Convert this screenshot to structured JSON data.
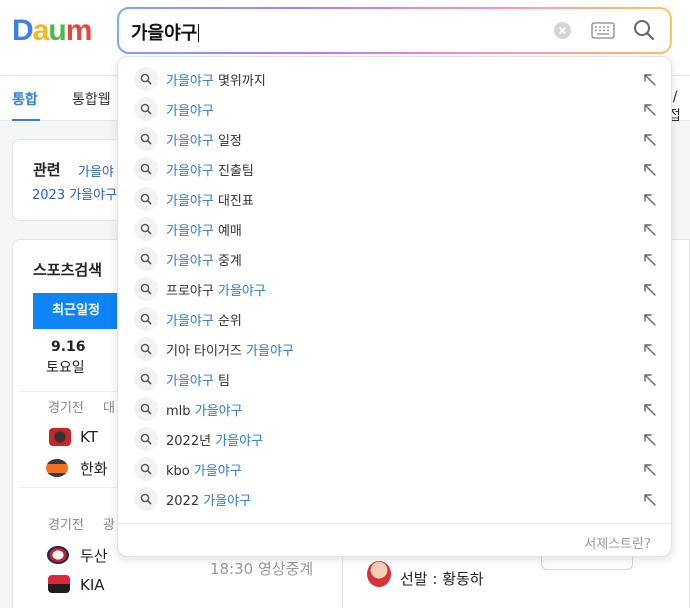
{
  "header": {
    "logo": "Daum",
    "search_value": "가을야구"
  },
  "nav": {
    "tabs": [
      "통합",
      "통합웹"
    ],
    "right_fragment": "|/접"
  },
  "related": {
    "title": "관련",
    "link1": "가을야",
    "link2": "2023 가을야구"
  },
  "sports": {
    "title": "스포츠검색",
    "tab_recent": "최근일정",
    "date": "9.16",
    "weekday": "토요일",
    "game1": {
      "label": "경기전",
      "venue": "대",
      "team1": "KT",
      "team2": "한화"
    },
    "game2": {
      "label": "경기전",
      "venue": "광",
      "team1": "두산",
      "team2": "KIA",
      "time": "18:30 영상중계",
      "pitcher": "선발 : 황동하"
    }
  },
  "suggestions": [
    {
      "before": "",
      "highlight": "가을야구",
      "after": " 몇위까지"
    },
    {
      "before": "",
      "highlight": "가을야구",
      "after": ""
    },
    {
      "before": "",
      "highlight": "가을야구",
      "after": " 일정"
    },
    {
      "before": "",
      "highlight": "가을야구",
      "after": " 진출팀"
    },
    {
      "before": "",
      "highlight": "가을야구",
      "after": " 대진표"
    },
    {
      "before": "",
      "highlight": "가을야구",
      "after": " 예매"
    },
    {
      "before": "",
      "highlight": "가을야구",
      "after": " 중계"
    },
    {
      "before": "프로야구 ",
      "highlight": "가을야구",
      "after": ""
    },
    {
      "before": "",
      "highlight": "가을야구",
      "after": " 순위"
    },
    {
      "before": "기아 타이거즈 ",
      "highlight": "가을야구",
      "after": ""
    },
    {
      "before": "",
      "highlight": "가을야구",
      "after": " 팀"
    },
    {
      "before": "mlb ",
      "highlight": "가을야구",
      "after": ""
    },
    {
      "before": "2022년 ",
      "highlight": "가을야구",
      "after": ""
    },
    {
      "before": "kbo ",
      "highlight": "가을야구",
      "after": ""
    },
    {
      "before": "2022 ",
      "highlight": "가을야구",
      "after": ""
    }
  ],
  "dropdown_footer": "서제스트란?",
  "colors": {
    "highlight": "#2b7bd8",
    "accent": "#0d85f5"
  }
}
